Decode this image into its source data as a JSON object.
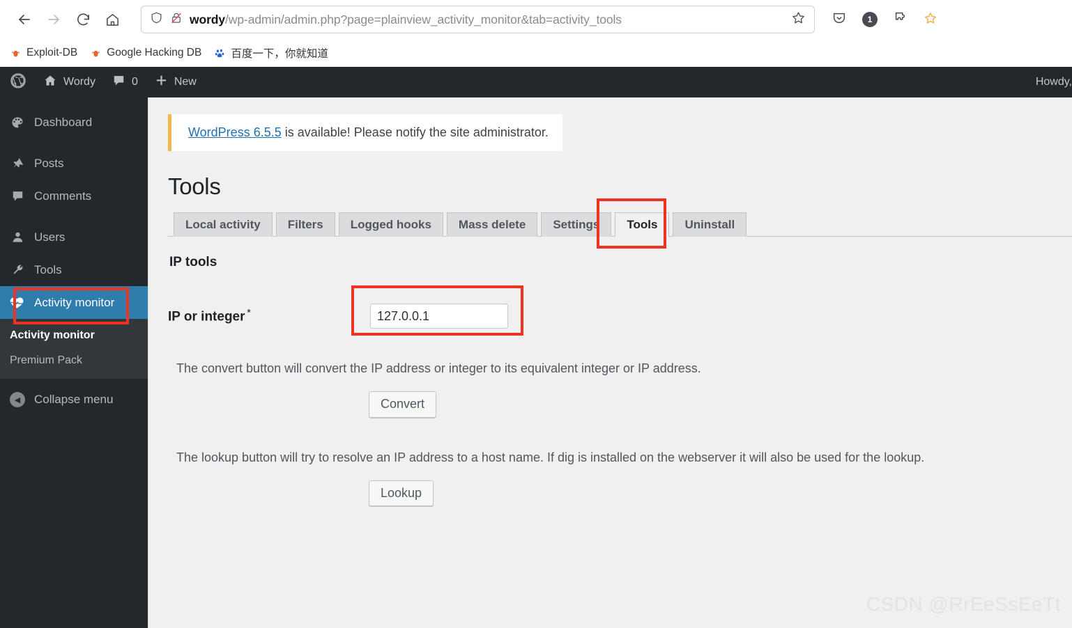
{
  "browser": {
    "nav": {
      "back": "back-arrow",
      "forward": "forward-arrow",
      "reload": "reload",
      "home": "home"
    },
    "url": {
      "host": "wordy",
      "path": "/wp-admin/admin.php?page=plainview_activity_monitor&tab=activity_tools",
      "shield_icon": "shield-icon",
      "lock_broken_icon": "lock-broken-icon",
      "bookmark_star_icon": "star-icon"
    },
    "toolbar_icons": [
      {
        "name": "pocket-icon",
        "label": ""
      },
      {
        "name": "notification-badge",
        "label": "1"
      },
      {
        "name": "extensions-icon",
        "label": ""
      },
      {
        "name": "bookmark-icon",
        "label": ""
      }
    ],
    "bookmarks": [
      {
        "label": "Exploit-DB",
        "icon": "bug-icon"
      },
      {
        "label": "Google Hacking DB",
        "icon": "bug-icon"
      },
      {
        "label": "百度一下，你就知道",
        "icon": "baidu-icon"
      }
    ]
  },
  "adminbar": {
    "wp_logo": "wordpress-logo",
    "site_name": "Wordy",
    "site_icon": "home-icon",
    "comments_icon": "comment-icon",
    "comments_count": "0",
    "new_icon": "plus-icon",
    "new_label": "New",
    "howdy": "Howdy,"
  },
  "sidebar": {
    "items": [
      {
        "label": "Dashboard",
        "icon": "dashboard-icon",
        "current": false
      },
      {
        "label": "Posts",
        "icon": "pin-icon",
        "current": false
      },
      {
        "label": "Comments",
        "icon": "comment-icon",
        "current": false
      },
      {
        "label": "Users",
        "icon": "user-icon",
        "current": false
      },
      {
        "label": "Tools",
        "icon": "wrench-icon",
        "current": false
      },
      {
        "label": "Activity monitor",
        "icon": "heartbeat-icon",
        "current": true
      }
    ],
    "submenu": [
      {
        "label": "Activity monitor",
        "active": true
      },
      {
        "label": "Premium Pack",
        "active": false
      }
    ],
    "collapse": {
      "label": "Collapse menu",
      "icon": "collapse-arrow-icon"
    }
  },
  "notice": {
    "link_text": "WordPress 6.5.5",
    "rest_text": " is available! Please notify the site administrator."
  },
  "main": {
    "page_title": "Tools",
    "tabs": [
      {
        "label": "Local activity",
        "active": false
      },
      {
        "label": "Filters",
        "active": false
      },
      {
        "label": "Logged hooks",
        "active": false
      },
      {
        "label": "Mass delete",
        "active": false
      },
      {
        "label": "Settings",
        "active": false
      },
      {
        "label": "Tools",
        "active": true
      },
      {
        "label": "Uninstall",
        "active": false
      }
    ],
    "section_title": "IP tools",
    "field": {
      "label": "IP or integer",
      "required_marker": "*",
      "value": "127.0.0.1",
      "placeholder": ""
    },
    "convert_help": "The convert button will convert the IP address or integer to its equivalent integer or IP address.",
    "convert_button": "Convert",
    "lookup_help": "The lookup button will try to resolve an IP address to a host name. If dig is installed on the webserver it will also be used for the lookup.",
    "lookup_button": "Lookup"
  },
  "watermark": "CSDN @RrEeSsEeTt",
  "colors": {
    "accent_blue": "#2e7dad",
    "admin_dark": "#23282d",
    "notice_amber": "#f0b849",
    "annotation_red": "#ee3322",
    "link_blue": "#2271b1"
  }
}
